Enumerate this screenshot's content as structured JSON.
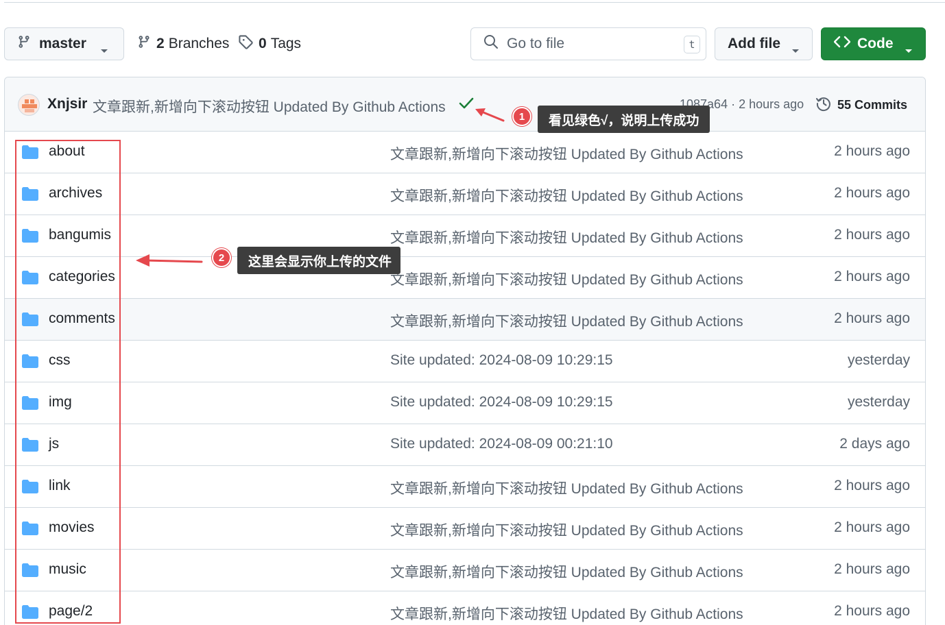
{
  "toolbar": {
    "branch": "master",
    "branches_count": "2",
    "branches_label": "Branches",
    "tags_count": "0",
    "tags_label": "Tags",
    "search_placeholder": "Go to file",
    "search_shortcut": "t",
    "add_file_label": "Add file",
    "code_label": "Code"
  },
  "latest_commit": {
    "author": "Xnjsir",
    "message": "文章跟新,新增向下滚动按钮 Updated By Github Actions",
    "status": "success",
    "hash_time": "1087a64 · 2 hours ago",
    "commits_label": "55 Commits"
  },
  "files": [
    {
      "name": "about",
      "message": "文章跟新,新增向下滚动按钮 Updated By Github Actions",
      "time": "2 hours ago"
    },
    {
      "name": "archives",
      "message": "文章跟新,新增向下滚动按钮 Updated By Github Actions",
      "time": "2 hours ago"
    },
    {
      "name": "bangumis",
      "message": "文章跟新,新增向下滚动按钮 Updated By Github Actions",
      "time": "2 hours ago"
    },
    {
      "name": "categories",
      "message": "文章跟新,新增向下滚动按钮 Updated By Github Actions",
      "time": "2 hours ago"
    },
    {
      "name": "comments",
      "message": "文章跟新,新增向下滚动按钮 Updated By Github Actions",
      "time": "2 hours ago"
    },
    {
      "name": "css",
      "message": "Site updated: 2024-08-09 10:29:15",
      "time": "yesterday"
    },
    {
      "name": "img",
      "message": "Site updated: 2024-08-09 10:29:15",
      "time": "yesterday"
    },
    {
      "name": "js",
      "message": "Site updated: 2024-08-09 00:21:10",
      "time": "2 days ago"
    },
    {
      "name": "link",
      "message": "文章跟新,新增向下滚动按钮 Updated By Github Actions",
      "time": "2 hours ago"
    },
    {
      "name": "movies",
      "message": "文章跟新,新增向下滚动按钮 Updated By Github Actions",
      "time": "2 hours ago"
    },
    {
      "name": "music",
      "message": "文章跟新,新增向下滚动按钮 Updated By Github Actions",
      "time": "2 hours ago"
    },
    {
      "name": "page/2",
      "message": "文章跟新,新增向下滚动按钮 Updated By Github Actions",
      "time": "2 hours ago"
    }
  ],
  "annotations": [
    {
      "number": "1",
      "text": "看见绿色√，说明上传成功"
    },
    {
      "number": "2",
      "text": "这里会显示你上传的文件"
    }
  ],
  "colors": {
    "accent_green": "#1f883d",
    "annotation_red": "#e5484d",
    "folder_blue": "#54aeff"
  }
}
